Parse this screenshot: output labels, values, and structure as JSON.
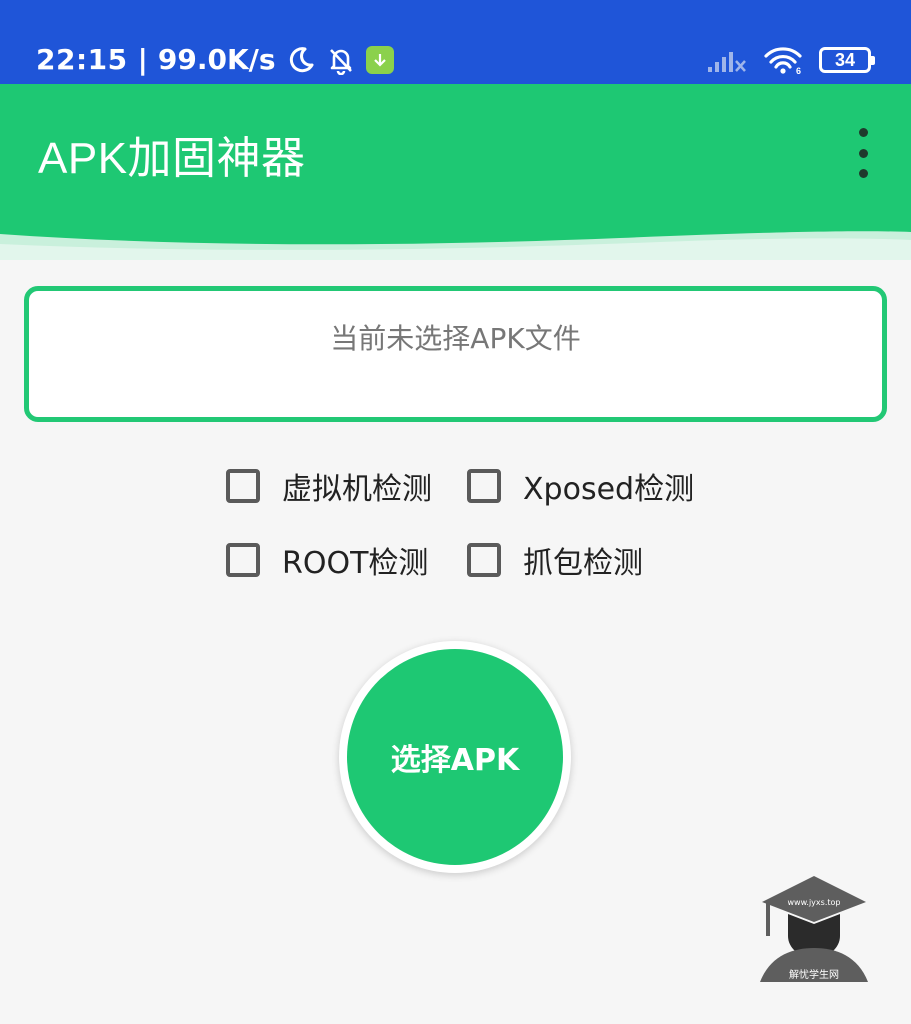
{
  "status_bar": {
    "time": "22:15",
    "separator": "|",
    "speed": "99.0K/s",
    "battery": "34",
    "icons": [
      "moon-icon",
      "bell-off-icon",
      "download-icon",
      "signal-icon",
      "wifi-icon",
      "battery-icon"
    ]
  },
  "app_bar": {
    "title": "APK加固神器",
    "menu_icon": "more-vert-icon"
  },
  "file_box": {
    "status": "当前未选择APK文件"
  },
  "options": [
    {
      "label": "虚拟机检测",
      "checked": false
    },
    {
      "label": "Xposed检测",
      "checked": false
    },
    {
      "label": "ROOT检测",
      "checked": false
    },
    {
      "label": "抓包检测",
      "checked": false
    }
  ],
  "select_button": {
    "label": "选择APK"
  },
  "watermark": {
    "url": "www.jyxs.top",
    "name": "解忧学生网"
  },
  "colors": {
    "status_bar": "#1f55d8",
    "accent": "#1ec873",
    "background": "#f6f6f6"
  }
}
